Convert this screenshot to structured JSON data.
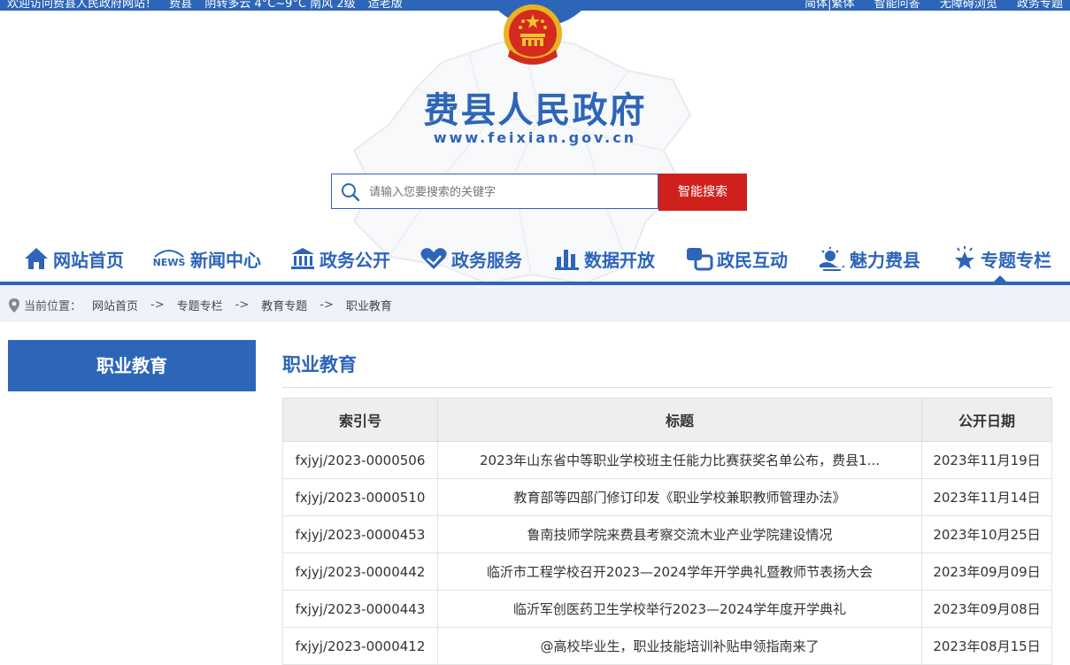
{
  "topbar": {
    "welcome": "欢迎访问费县人民政府网站！",
    "location": "费县",
    "weather": "阴转多云 4°C~9°C 南风 2级",
    "aging": "适老版",
    "right_links": [
      "简体|繁体",
      "智能问答",
      "无障碍浏览",
      "政务专题"
    ]
  },
  "header": {
    "site_title": "费县人民政府",
    "site_url": "www.feixian.gov.cn"
  },
  "search": {
    "placeholder": "请输入您要搜索的关键字",
    "button_label": "智能搜索"
  },
  "nav": {
    "items": [
      {
        "label": "网站首页",
        "icon": "home-icon"
      },
      {
        "label": "新闻中心",
        "icon": "news-icon"
      },
      {
        "label": "政务公开",
        "icon": "government-building-icon"
      },
      {
        "label": "政务服务",
        "icon": "heart-hands-icon"
      },
      {
        "label": "数据开放",
        "icon": "bar-chart-icon"
      },
      {
        "label": "政民互动",
        "icon": "interaction-icon"
      },
      {
        "label": "魅力费县",
        "icon": "scenery-icon"
      },
      {
        "label": "专题专栏",
        "icon": "star-icon"
      }
    ],
    "active_index": 7
  },
  "breadcrumb": {
    "prefix": "当前位置：",
    "items": [
      "网站首页",
      "专题专栏",
      "教育专题",
      "职业教育"
    ],
    "separator": "->"
  },
  "sidebar": {
    "title": "职业教育"
  },
  "content": {
    "title": "职业教育",
    "columns": [
      "索引号",
      "标题",
      "公开日期"
    ],
    "rows": [
      {
        "index": "fxjyj/2023-0000506",
        "title": "2023年山东省中等职业学校班主任能力比赛获奖名单公布，费县1...",
        "date": "2023年11月19日"
      },
      {
        "index": "fxjyj/2023-0000510",
        "title": "教育部等四部门修订印发《职业学校兼职教师管理办法》",
        "date": "2023年11月14日"
      },
      {
        "index": "fxjyj/2023-0000453",
        "title": "鲁南技师学院来费县考察交流木业产业学院建设情况",
        "date": "2023年10月25日"
      },
      {
        "index": "fxjyj/2023-0000442",
        "title": "临沂市工程学校召开2023—2024学年开学典礼暨教师节表扬大会",
        "date": "2023年09月09日"
      },
      {
        "index": "fxjyj/2023-0000443",
        "title": "临沂军创医药卫生学校举行2023—2024学年度开学典礼",
        "date": "2023年09月08日"
      },
      {
        "index": "fxjyj/2023-0000412",
        "title": "@高校毕业生，职业技能培训补贴申领指南来了",
        "date": "2023年08月15日"
      }
    ]
  },
  "colors": {
    "brand_blue": "#2d65b8",
    "search_red": "#d0201c",
    "crumb_bg": "#eef3fa"
  }
}
